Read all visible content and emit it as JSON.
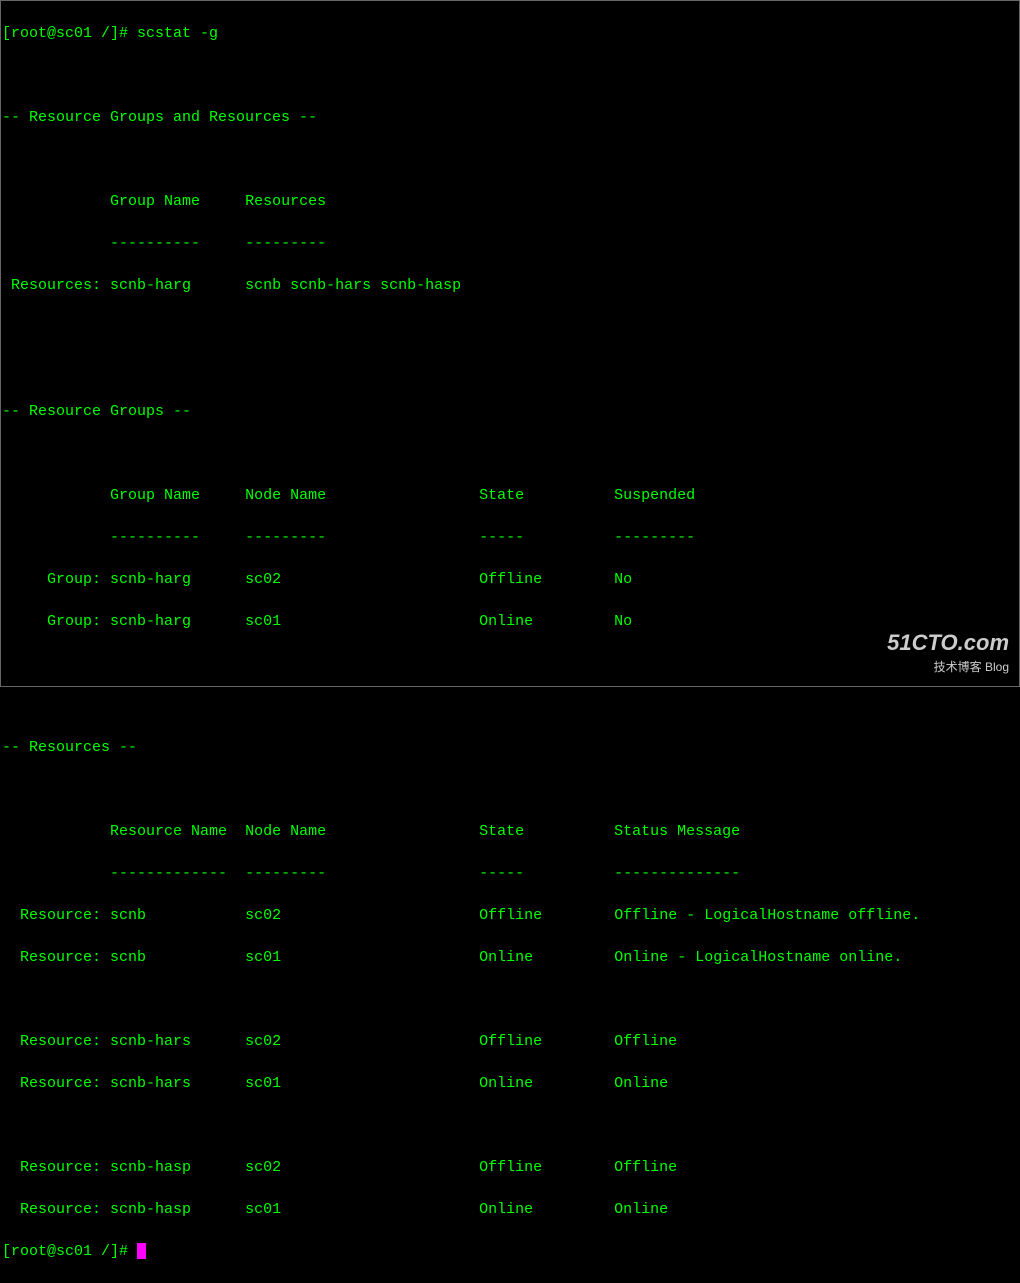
{
  "prompt1": {
    "user_host": "[root@sc01 /]#",
    "command": "scstat -g"
  },
  "section1": {
    "title": "-- Resource Groups and Resources --",
    "headers": {
      "col1": "Group Name",
      "col2": "Resources"
    },
    "sep": {
      "col1": "----------",
      "col2": "---------"
    },
    "row_label": "Resources:",
    "rows": [
      {
        "name": "scnb-harg",
        "resources": "scnb scnb-hars scnb-hasp"
      }
    ]
  },
  "section2": {
    "title": "-- Resource Groups --",
    "headers": {
      "col1": "Group Name",
      "col2": "Node Name",
      "col3": "State",
      "col4": "Suspended"
    },
    "sep": {
      "col1": "----------",
      "col2": "---------",
      "col3": "-----",
      "col4": "---------"
    },
    "row_label": "Group:",
    "rows": [
      {
        "name": "scnb-harg",
        "node": "sc02",
        "state": "Offline",
        "suspended": "No"
      },
      {
        "name": "scnb-harg",
        "node": "sc01",
        "state": "Online",
        "suspended": "No"
      }
    ]
  },
  "section3": {
    "title": "-- Resources --",
    "headers": {
      "col1": "Resource Name",
      "col2": "Node Name",
      "col3": "State",
      "col4": "Status Message"
    },
    "sep": {
      "col1": "-------------",
      "col2": "---------",
      "col3": "-----",
      "col4": "--------------"
    },
    "row_label": "Resource:",
    "rows": [
      {
        "name": "scnb",
        "node": "sc02",
        "state": "Offline",
        "status": "Offline - LogicalHostname offline."
      },
      {
        "name": "scnb",
        "node": "sc01",
        "state": "Online",
        "status": "Online - LogicalHostname online."
      }
    ],
    "rows2": [
      {
        "name": "scnb-hars",
        "node": "sc02",
        "state": "Offline",
        "status": "Offline"
      },
      {
        "name": "scnb-hars",
        "node": "sc01",
        "state": "Online",
        "status": "Online"
      }
    ],
    "rows3": [
      {
        "name": "scnb-hasp",
        "node": "sc02",
        "state": "Offline",
        "status": "Offline"
      },
      {
        "name": "scnb-hasp",
        "node": "sc01",
        "state": "Online",
        "status": "Online"
      }
    ]
  },
  "prompt2": {
    "user_host": "[root@sc01 /]#"
  },
  "watermark": {
    "logo": "51CTO.com",
    "sub": "技术博客   Blog"
  }
}
